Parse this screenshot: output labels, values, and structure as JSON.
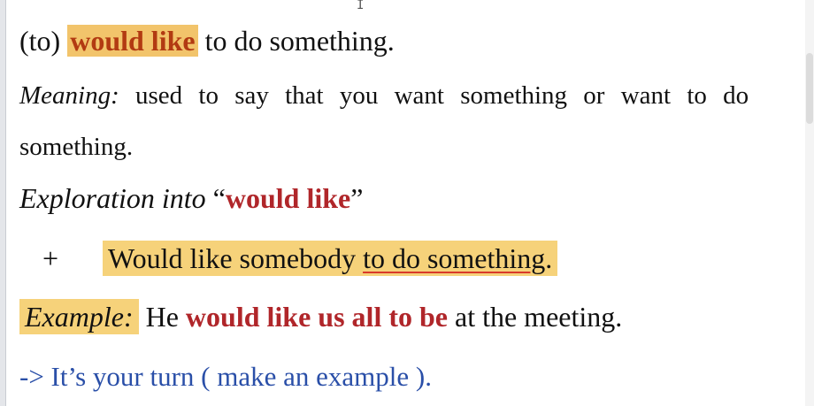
{
  "line1": {
    "prefix": "(to) ",
    "highlight": "would like",
    "suffix": " to do something."
  },
  "meaning": {
    "label": "Meaning:",
    "text": " used to say that you want something or want to do",
    "continuation": "something."
  },
  "exploration": {
    "label": "Exploration into ",
    "open_quote": "“",
    "phrase": "would like",
    "close_quote": "”"
  },
  "pattern": {
    "bullet": "+",
    "part1": "Would like somebody ",
    "part2": "to do something",
    "end": "."
  },
  "example": {
    "label": "Example:",
    "pre": " He ",
    "bold": "would like us all to be",
    "post": " at the meeting."
  },
  "prompt": {
    "text": "-> It’s your turn ( make an example )."
  },
  "colors": {
    "highlight_orange": "#f2c46b",
    "highlight_yellow": "#f6d27a",
    "emphasis_red": "#b0262a",
    "link_blue": "#2a4fa8"
  }
}
